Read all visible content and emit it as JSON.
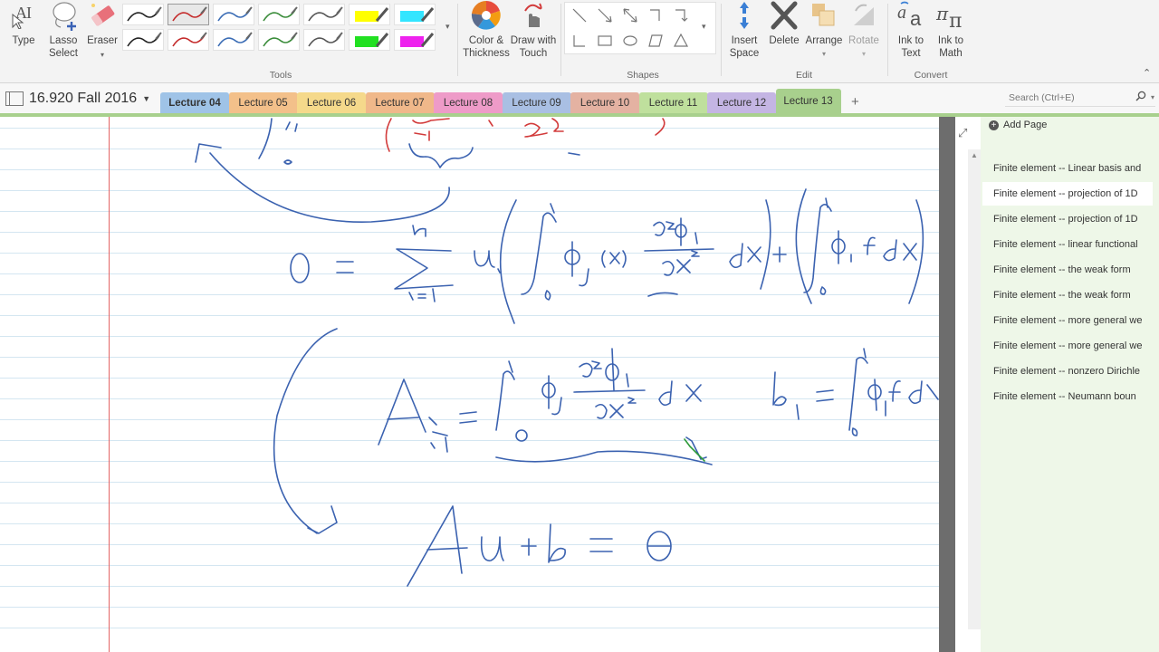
{
  "ribbon": {
    "buttons": {
      "type": "Type",
      "lasso": "Lasso\nSelect",
      "eraser": "Eraser",
      "color": "Color &\nThickness",
      "draw_touch": "Draw with\nTouch",
      "insert_space": "Insert\nSpace",
      "delete": "Delete",
      "arrange": "Arrange",
      "rotate": "Rotate",
      "ink_text": "Ink to\nText",
      "ink_math": "Ink to\nMath"
    },
    "groups": {
      "tools": "Tools",
      "shapes": "Shapes",
      "edit": "Edit",
      "convert": "Convert"
    },
    "pens": [
      {
        "color": "#222222",
        "hl": false
      },
      {
        "color": "#c42b2b",
        "hl": false
      },
      {
        "color": "#3a6cb5",
        "hl": false
      },
      {
        "color": "#3a8c3a",
        "hl": false
      },
      {
        "color": "#555555",
        "hl": false
      },
      {
        "color": "#ffff00",
        "hl": true
      },
      {
        "color": "#33e5ff",
        "hl": true
      },
      {
        "color": "#222222",
        "hl": false
      },
      {
        "color": "#c42b2b",
        "hl": false
      },
      {
        "color": "#3a6cb5",
        "hl": false
      },
      {
        "color": "#3a8c3a",
        "hl": false
      },
      {
        "color": "#555555",
        "hl": false
      },
      {
        "color": "#22e022",
        "hl": true
      },
      {
        "color": "#ee22ee",
        "hl": true
      }
    ]
  },
  "notebook": {
    "name": "16.920 Fall 2016"
  },
  "sections": [
    {
      "label": "Lecture 04",
      "color": "#9fc3e7"
    },
    {
      "label": "Lecture 05",
      "color": "#f3c08a"
    },
    {
      "label": "Lecture 06",
      "color": "#f5d98b"
    },
    {
      "label": "Lecture 07",
      "color": "#f0b88a"
    },
    {
      "label": "Lecture 08",
      "color": "#ee9bc8"
    },
    {
      "label": "Lecture 09",
      "color": "#a9bfe3"
    },
    {
      "label": "Lecture 10",
      "color": "#e4b2a2"
    },
    {
      "label": "Lecture 11",
      "color": "#bfe09d"
    },
    {
      "label": "Lecture 12",
      "color": "#c4b5e3"
    },
    {
      "label": "Lecture 13",
      "color": "#a8d08d"
    }
  ],
  "active_section": "Lecture 13",
  "search": {
    "placeholder": "Search (Ctrl+E)"
  },
  "pagepane": {
    "add_page": "Add Page",
    "pages": [
      "Finite element -- Linear basis and",
      "Finite element -- projection of 1D",
      "Finite element -- projection of 1D",
      "Finite element -- linear functional",
      "Finite element -- the weak form",
      "Finite element -- the weak form",
      "Finite element -- more general we",
      "Finite element -- more general we",
      "Finite element -- nonzero Dirichle",
      "Finite element -- Neumann boun"
    ],
    "selected_index": 1
  },
  "colors": {
    "ink_blue": "#3b62b0",
    "ink_red": "#d23b3b",
    "ink_green": "#2e9a3a",
    "margin_red": "#e46464",
    "rule_blue": "#d4e6f1",
    "accent_green": "#a8d08d"
  }
}
